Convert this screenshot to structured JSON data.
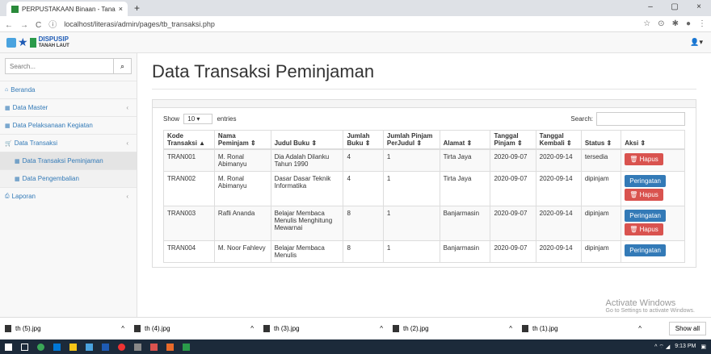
{
  "browser": {
    "tab_title": "PERPUSTAKAAN Binaan - Tanah",
    "tab_close": "×",
    "new_tab": "+",
    "url": "localhost/literasi/admin/pages/tb_transaksi.php",
    "win_min": "–",
    "win_max": "▢",
    "win_close": "×"
  },
  "header": {
    "logo_text": "DISPUSIP",
    "logo_sub": "TANAH LAUT",
    "user_icon": "user-icon"
  },
  "sidebar": {
    "search_placeholder": "Search...",
    "items": [
      {
        "label": "Beranda",
        "icon": "home-icon"
      },
      {
        "label": "Data Master",
        "icon": "table-icon",
        "chevron": "‹"
      },
      {
        "label": "Data Pelaksanaan Kegiatan",
        "icon": "table-icon"
      },
      {
        "label": "Data Transaksi",
        "icon": "cart-icon",
        "chevron": "‹"
      },
      {
        "label": "Data Transaksi Peminjaman",
        "icon": "table-icon"
      },
      {
        "label": "Data Pengembalian",
        "icon": "table-icon"
      },
      {
        "label": "Laporan",
        "icon": "print-icon",
        "chevron": "‹"
      }
    ]
  },
  "main": {
    "page_title": "Data Transaksi Peminjaman",
    "show_label": "Show",
    "entries_value": "10",
    "entries_label": "entries",
    "search_label": "Search:",
    "columns": [
      "Kode Transaksi",
      "Nama Peminjam",
      "Judul Buku",
      "Jumlah Buku",
      "Jumlah Pinjam PerJudul",
      "Alamat",
      "Tanggal Pinjam",
      "Tanggal Kembali",
      "Status",
      "Aksi"
    ],
    "rows": [
      {
        "kode": "TRAN001",
        "nama": "M. Ronal Abimanyu",
        "judul": "Dia Adalah Dilanku Tahun 1990",
        "jumlah": "4",
        "per_judul": "1",
        "alamat": "Tirta Jaya",
        "pinjam": "2020-09-07",
        "kembali": "2020-09-14",
        "status": "tersedia",
        "aksi": [
          "Hapus"
        ]
      },
      {
        "kode": "TRAN002",
        "nama": "M. Ronal Abimanyu",
        "judul": "Dasar Dasar Teknik Informatika",
        "jumlah": "4",
        "per_judul": "1",
        "alamat": "Tirta Jaya",
        "pinjam": "2020-09-07",
        "kembali": "2020-09-14",
        "status": "dipinjam",
        "aksi": [
          "Peringatan",
          "Hapus"
        ]
      },
      {
        "kode": "TRAN003",
        "nama": "Rafli Ananda",
        "judul": "Belajar Membaca Menulis Menghitung Mewarnai",
        "jumlah": "8",
        "per_judul": "1",
        "alamat": "Banjarmasin",
        "pinjam": "2020-09-07",
        "kembali": "2020-09-14",
        "status": "dipinjam",
        "aksi": [
          "Peringatan",
          "Hapus"
        ]
      },
      {
        "kode": "TRAN004",
        "nama": "M. Noor Fahlevy",
        "judul": "Belajar Membaca Menulis",
        "jumlah": "8",
        "per_judul": "1",
        "alamat": "Banjarmasin",
        "pinjam": "2020-09-07",
        "kembali": "2020-09-14",
        "status": "dipinjam",
        "aksi": [
          "Peringatan"
        ]
      }
    ],
    "watermark": "Activate Windows",
    "watermark_sub": "Go to Settings to activate Windows."
  },
  "downloads": {
    "files": [
      "th (5).jpg",
      "th (4).jpg",
      "th (3).jpg",
      "th (2).jpg",
      "th (1).jpg"
    ],
    "show_all": "Show all"
  },
  "taskbar": {
    "time": "9:13 PM"
  },
  "colors": {
    "danger": "#d9534f",
    "primary": "#337ab7",
    "link": "#337ab7"
  }
}
